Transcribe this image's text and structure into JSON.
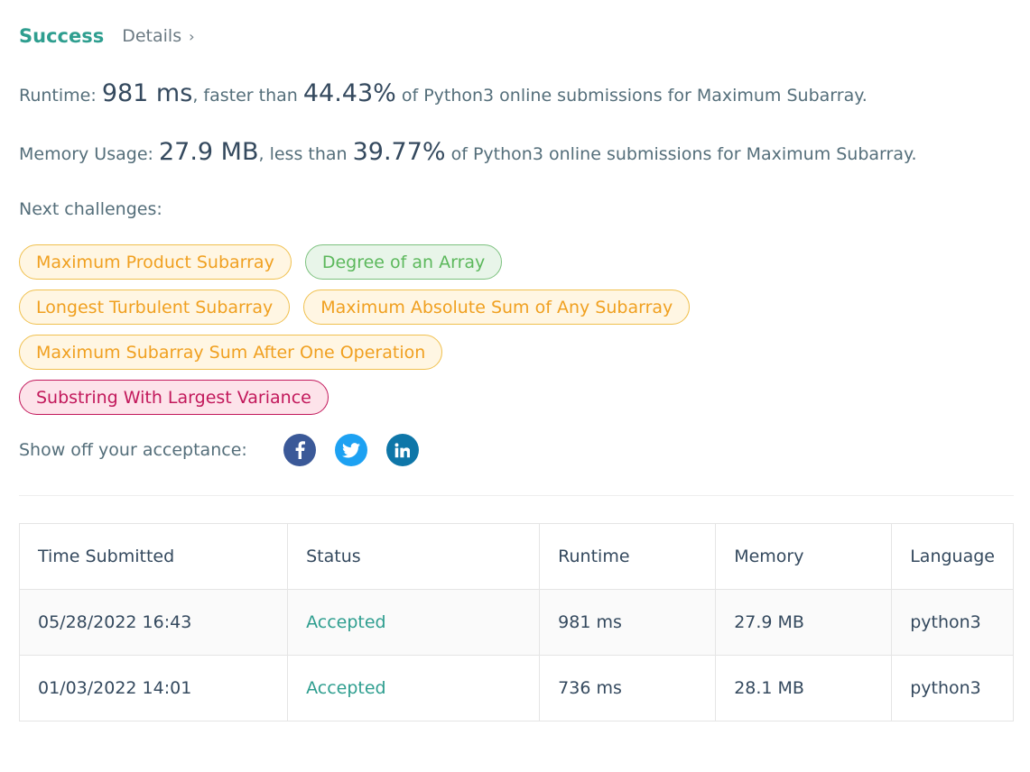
{
  "header": {
    "status": "Success",
    "details_label": "Details",
    "details_chevron": "›"
  },
  "runtime": {
    "label": "Runtime:",
    "value": "981 ms",
    "comparison": ", faster than",
    "percent": "44.43%",
    "suffix": "of Python3 online submissions for Maximum Subarray."
  },
  "memory": {
    "label": "Memory Usage:",
    "value": "27.9 MB",
    "comparison": ", less than",
    "percent": "39.77%",
    "suffix": "of Python3 online submissions for Maximum Subarray."
  },
  "next": {
    "label": "Next challenges:",
    "challenges": [
      {
        "name": "Maximum Product Subarray",
        "difficulty": "medium"
      },
      {
        "name": "Degree of an Array",
        "difficulty": "easy"
      },
      {
        "name": "Longest Turbulent Subarray",
        "difficulty": "medium"
      },
      {
        "name": "Maximum Absolute Sum of Any Subarray",
        "difficulty": "medium"
      },
      {
        "name": "Maximum Subarray Sum After One Operation",
        "difficulty": "medium"
      },
      {
        "name": "Substring With Largest Variance",
        "difficulty": "hard"
      }
    ]
  },
  "share": {
    "label": "Show off your acceptance:",
    "icons": [
      "facebook-icon",
      "twitter-icon",
      "linkedin-icon"
    ]
  },
  "table": {
    "headers": [
      "Time Submitted",
      "Status",
      "Runtime",
      "Memory",
      "Language"
    ],
    "rows": [
      [
        "05/28/2022 16:43",
        "Accepted",
        "981 ms",
        "27.9 MB",
        "python3"
      ],
      [
        "01/03/2022 14:01",
        "Accepted",
        "736 ms",
        "28.1 MB",
        "python3"
      ]
    ]
  },
  "colors": {
    "accent": "#2e9e8f",
    "medium": "#f0a020",
    "easy": "#5cb85c",
    "hard": "#c2185b",
    "facebook": "#3b5998",
    "twitter": "#1da1f2",
    "linkedin": "#0e76a8"
  }
}
